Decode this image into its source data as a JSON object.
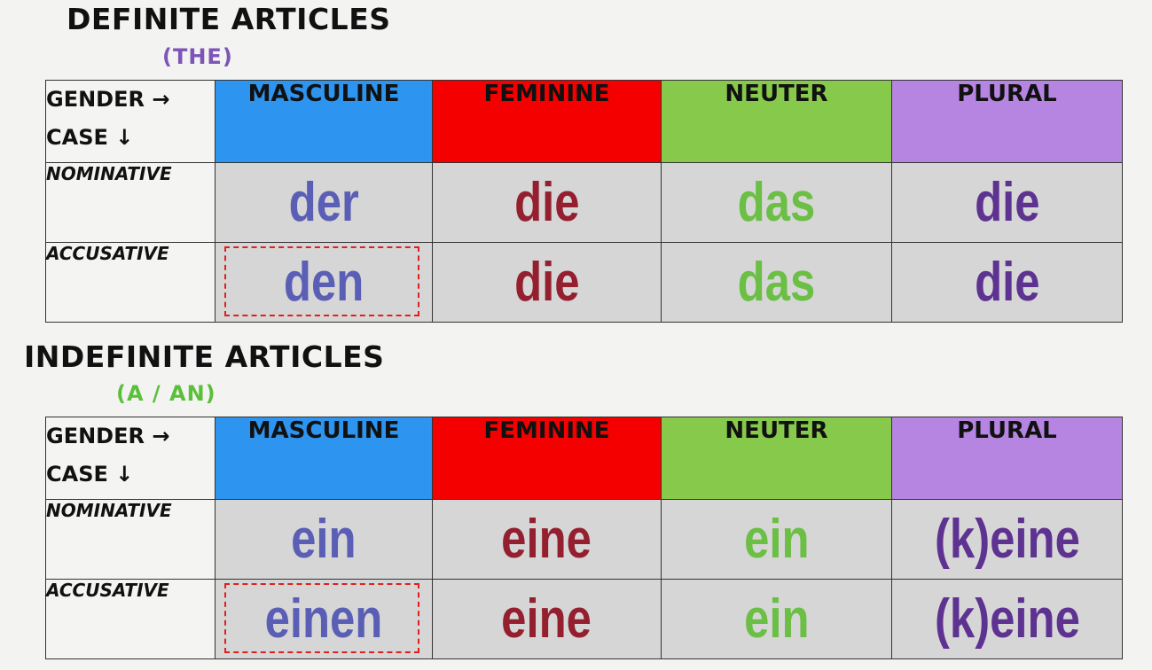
{
  "colors": {
    "masculine_header": "#2d94ef",
    "feminine_header": "#f50000",
    "neuter_header": "#87c94a",
    "plural_header": "#b685e1",
    "masculine_text": "#5a5fb5",
    "feminine_text": "#94202f",
    "neuter_text": "#6bbf45",
    "plural_text": "#5e3291",
    "cell_background": "#d6d6d6",
    "highlight_dash": "#e02020"
  },
  "definite": {
    "title": "DEFINITE ARTICLES",
    "subtitle": "(THE)",
    "corner_gender": "GENDER →",
    "corner_case": "CASE ↓",
    "columns": [
      "MASCULINE",
      "FEMININE",
      "NEUTER",
      "PLURAL"
    ],
    "rows": [
      {
        "label": "NOMINATIVE",
        "cells": [
          "der",
          "die",
          "das",
          "die"
        ]
      },
      {
        "label": "ACCUSATIVE",
        "cells": [
          "den",
          "die",
          "das",
          "die"
        ]
      }
    ]
  },
  "indefinite": {
    "title": "INDEFINITE ARTICLES",
    "subtitle": "(A / AN)",
    "corner_gender": "GENDER →",
    "corner_case": "CASE ↓",
    "columns": [
      "MASCULINE",
      "FEMININE",
      "NEUTER",
      "PLURAL"
    ],
    "rows": [
      {
        "label": "NOMINATIVE",
        "cells": [
          "ein",
          "eine",
          "ein",
          "(k)eine"
        ]
      },
      {
        "label": "ACCUSATIVE",
        "cells": [
          "einen",
          "eine",
          "ein",
          "(k)eine"
        ]
      }
    ]
  }
}
